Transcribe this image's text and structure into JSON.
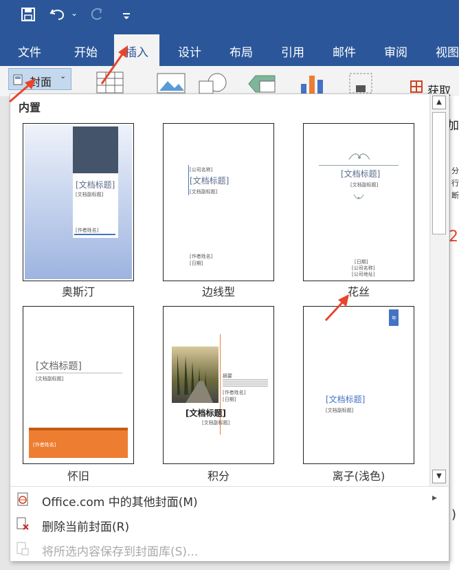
{
  "quick_access": {
    "save_icon": "save-icon",
    "undo_icon": "undo-icon",
    "redo_icon": "redo-icon",
    "customize_icon": "customize-icon",
    "undo_drop": "⌄"
  },
  "tabs": [
    {
      "label": "文件"
    },
    {
      "label": "开始"
    },
    {
      "label": "插入"
    },
    {
      "label": "设计"
    },
    {
      "label": "布局"
    },
    {
      "label": "引用"
    },
    {
      "label": "邮件"
    },
    {
      "label": "审阅"
    },
    {
      "label": "视图"
    }
  ],
  "ribbon": {
    "cover_label": "封面",
    "cover_caret": "⌄",
    "right_text_1": "获取加",
    "right_text_2": "加"
  },
  "side_fragments": {
    "a": "分",
    "b": "行",
    "c": "断",
    "d": "2",
    "e": ")"
  },
  "gallery": {
    "section_title": "内置",
    "items": [
      {
        "caption": "奥斯汀",
        "doc_title": "[文档标题]",
        "subtitle": "[文档副标题]",
        "author": "[作者姓名]"
      },
      {
        "caption": "边线型",
        "doc_title": "[文档标题]",
        "company": "[公司名称]",
        "subtitle": "[文档副标题]",
        "author": "[作者姓名]",
        "date": "[日期]"
      },
      {
        "caption": "花丝",
        "doc_title": "[文档标题]",
        "subtitle": "[文档副标题]",
        "date": "[日期]",
        "company": "[公司名称]",
        "address": "[公司地址]"
      },
      {
        "caption": "怀旧",
        "doc_title": "[文档标题]",
        "subtitle": "[文档副标题]",
        "author": "[作者姓名]"
      },
      {
        "caption": "积分",
        "doc_title": "[文档标题]",
        "subtitle": "[文档副标题]",
        "abstract": "摘要",
        "author": "[作者姓名]",
        "date": "[日期]"
      },
      {
        "caption": "离子(浅色)",
        "doc_title": "[文档标题]",
        "subtitle": "[文档副标题]",
        "year": "年"
      }
    ]
  },
  "menu": {
    "more_covers": "Office.com 中的其他封面(M)",
    "more_arrow": "▸",
    "remove_cover": "删除当前封面(R)",
    "save_selection": "将所选内容保存到封面库(S)..."
  },
  "scrollbar": {
    "up": "▲",
    "down": "▼"
  },
  "colors": {
    "accent": "#2b579a",
    "annotation": "#e8452c",
    "orange": "#ed7d31",
    "navy": "#44546a",
    "blue": "#4472c4"
  }
}
